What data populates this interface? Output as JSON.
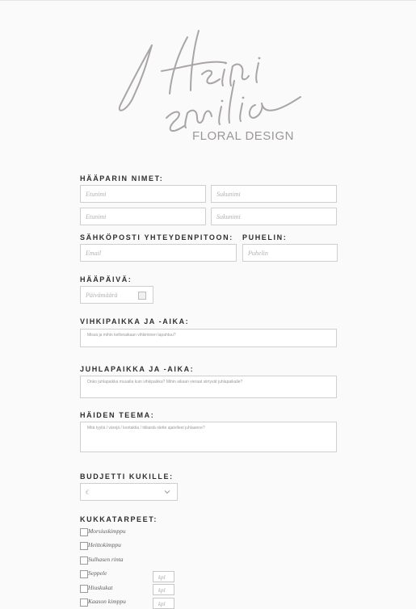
{
  "logo": {
    "subtitle": "FLORAL DESIGN"
  },
  "couple": {
    "label": "HÄÄPARIN NIMET:",
    "first_name_placeholder": "Etunimi",
    "last_name_placeholder": "Sukunimi"
  },
  "contact": {
    "email_label": "SÄHKÖPOSTI YHTEYDENPITOON:",
    "email_placeholder": "Email",
    "phone_label": "PUHELIN:",
    "phone_placeholder": "Puhelin"
  },
  "wedding_date": {
    "label": "HÄÄPÄIVÄ:",
    "placeholder": "Päivämäärä"
  },
  "ceremony": {
    "label": "VIHKIPAIKKA JA -AIKA:",
    "placeholder": "Missä ja mihin kellonaikaan vihkiminen tapahtuu?"
  },
  "reception": {
    "label": "JUHLAPAIKKA JA -AIKA:",
    "placeholder": "Onko juhlapaikka muualla kuin vihkipaikka? Mihin aikaan vieraat siirtyvät juhlapaikalle?"
  },
  "theme": {
    "label": "HÄIDEN TEEMA:",
    "placeholder": "Mitä tyyliä / värejä / kontaktia / tiiliaistä olette ajatelleet juhlaanne?"
  },
  "budget": {
    "label": "BUDJETTI KUKILLE:",
    "value": "€"
  },
  "flowers": {
    "label": "KUKKATARPEET:",
    "qty_placeholder": "kpl",
    "items": [
      {
        "label": "Morsiuskimppu",
        "checked": false
      },
      {
        "label": "Heittokimppu",
        "checked": false
      },
      {
        "label": "Sulhasen rinta",
        "checked": false
      },
      {
        "label": "Seppele",
        "checked": false
      },
      {
        "label": "Hiuskukat",
        "checked": false
      },
      {
        "label": "Kaason kimppu",
        "checked": false
      }
    ]
  }
}
